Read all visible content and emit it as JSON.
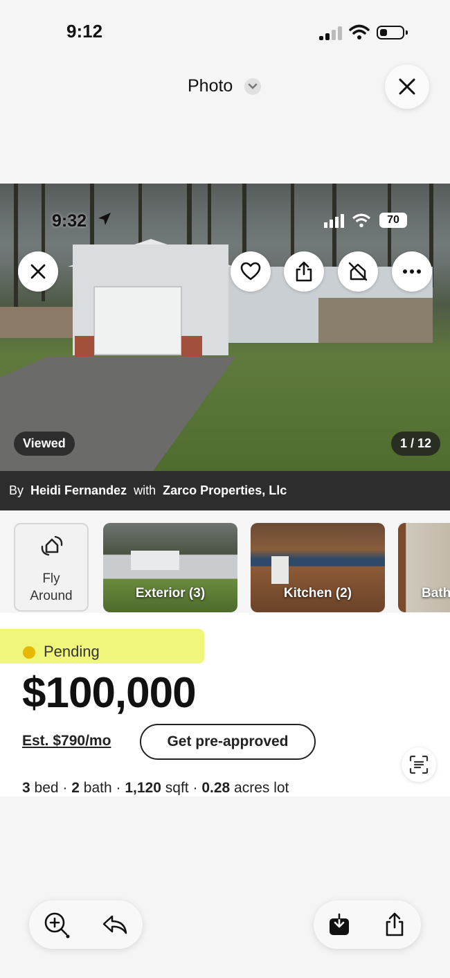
{
  "status_bar": {
    "time": "9:12",
    "icons": [
      "cellular-signal-icon",
      "wifi-icon",
      "battery-icon"
    ]
  },
  "viewer": {
    "title": "Photo",
    "close_icon": "close-icon",
    "chevron_icon": "chevron-down-icon"
  },
  "photo": {
    "inner_status_time": "9:32",
    "inner_battery": "70",
    "actions": [
      "close-icon",
      "heart-icon",
      "share-icon",
      "hide-icon",
      "more-icon"
    ],
    "viewed_badge": "Viewed",
    "counter": "1 / 12"
  },
  "attribution": {
    "prefix": "By",
    "agent": "Heidi Fernandez",
    "middle": "with",
    "brokerage": "Zarco Properties, Llc"
  },
  "thumbnails": {
    "fly_around": {
      "line1": "Fly",
      "line2": "Around"
    },
    "items": [
      {
        "label": "Exterior (3)"
      },
      {
        "label": "Kitchen (2)"
      },
      {
        "label": "Bath"
      }
    ]
  },
  "listing": {
    "status": "Pending",
    "status_color": "#e6b800",
    "highlight_color": "#eef56a",
    "price": "$100,000",
    "est_payment": "Est. $790/mo",
    "cta": "Get pre-approved",
    "beds": "3",
    "beds_label": "bed",
    "baths": "2",
    "baths_label": "bath",
    "sqft": "1,120",
    "sqft_label": "sqft",
    "lot": "0.28",
    "lot_label": "acres lot",
    "sep": "·"
  },
  "toolbar": {
    "left": [
      "zoom-in-icon",
      "reply-icon"
    ],
    "right": [
      "save-download-icon",
      "share-icon"
    ]
  }
}
